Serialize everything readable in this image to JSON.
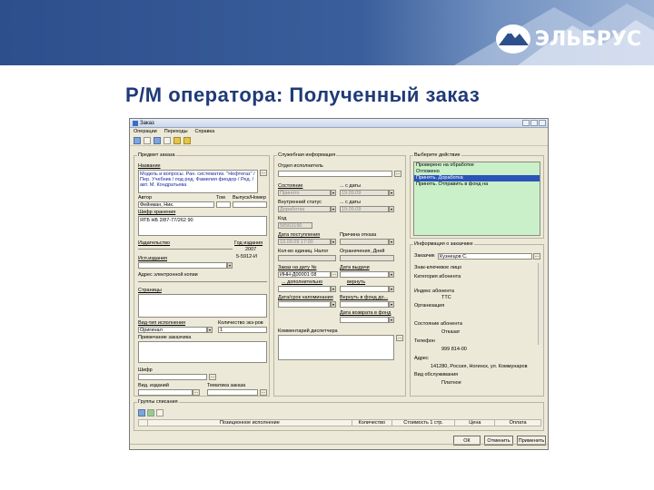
{
  "brand": {
    "logo_text": "ЭЛЬБРУС"
  },
  "slide": {
    "title": "Р/М оператора: Полученный заказ"
  },
  "window": {
    "title": "Заказ",
    "menu": [
      "Операции",
      "Переходы",
      "Справка"
    ]
  },
  "left": {
    "group_title": "Предмет заказа",
    "name_label": "Название",
    "name_value": "Модель и вопросы. Ран. систематиз. \"Нефтегаз\" / Пер. Учебник / под ред. Фамилия фиодор / Ред. / авт. М. Кондратьева",
    "author_label": "Автор",
    "author_value": "Фейнман, Ник.",
    "tom_label": "Том",
    "release_label": "Выпуск/Номер",
    "cipher_label": "Шифр хранения",
    "cipher_value": "ЯТБ НБ 2/87-77/262 90",
    "publisher_label": "Издательство",
    "year_label": "Год издания",
    "year_value": "2007",
    "isbn_label": "Исп.издания",
    "isbn_value": "5-5912-И",
    "email_label": "Адрес электронной копии",
    "pages_label": "Страницы",
    "exec_type_label": "Вид-тип исполнения",
    "exec_type_value": "Оригинал",
    "copies_label": "Количество экз-ров",
    "copies_value": "1",
    "note_label": "Примечание заказчика",
    "stamp_label": "Шифр",
    "issues_label": "Вид. изданий",
    "subject_label": "Тематика заказа"
  },
  "middle": {
    "group_title": "Служебная информация",
    "dept_label": "Отдел исполнитель",
    "state_label": "Состояние",
    "state_value": "Принято",
    "from_label": "... с даты",
    "from_value": "19.09.09",
    "inner_state_label": "Внутренний статус",
    "inner_state_value": "Доработка",
    "from2_label": "... с даты",
    "from2_value": "19.09.09",
    "code_label": "Код",
    "code_value": "58563190",
    "recv_label": "Дата поступления",
    "recv_value": "19.09.09 17:00",
    "grounds_label": "Причина отказа",
    "pieces_label": "Кол-во единиц. Налог",
    "limits_label": "Ограничения, Дней",
    "order_no_label": "Заказ на дату №",
    "order_no_value": "ИНН-Д00001 08",
    "issue_date_label": "Дата выдачи",
    "sub_label": "... дополнительно",
    "return_label": "вернуть",
    "reminder_label": "Дата/срок напоминания",
    "reminder_value": "Вернуть в фонд до...",
    "return_date_label": "Дата возврата в фонд",
    "comment_label": "Комментарий диспетчера"
  },
  "right": {
    "action_title": "Выберите действие",
    "actions": [
      "Проверено на обработке",
      "Отложено",
      "Принять. Доработка",
      "Принять. Отправить в фонд на"
    ],
    "selected_index": 2,
    "client_title": "Информация о заказчике",
    "client_name_label": "Заказчик",
    "client_name_value": "Кузнецов С.",
    "short_name_label": "Знак-ключевое лицо",
    "category_label": "Категория абонента",
    "id_label": "Индекс абонента",
    "id_value": "ТТС",
    "org_label": "Организация",
    "status_label": "Состояние абонента",
    "status_value": "Отказат",
    "phone_label": "Телефон",
    "phone_value": "999 814-00",
    "address_label": "Адрес",
    "address_value": "141280, Россия, Ногинск, ул. Коммунаров",
    "pay_label": "Вид обслуживания",
    "pay_value": "Платное"
  },
  "bottom": {
    "group_title": "Группы списания",
    "columns": [
      "Позиционное исполнение",
      "Количество",
      "Стоимость 1 стр.",
      "Цена",
      "Оплата"
    ]
  },
  "buttons": {
    "ok": "ОК",
    "cancel": "Отменить",
    "apply": "Применить"
  },
  "colors": {
    "banner": "#2d4f8c",
    "title": "#1f3a78",
    "list_bg": "#c9f0c9",
    "selection": "#2b54b8"
  }
}
